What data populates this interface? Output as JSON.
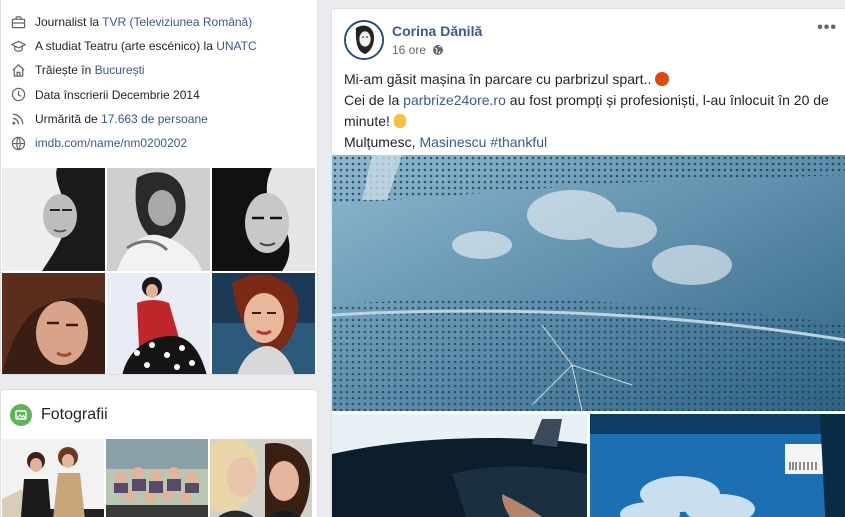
{
  "intro": {
    "work": {
      "prefix": "Journalist la ",
      "org": "TVR",
      "suffix": " (Televiziunea Română)"
    },
    "education": {
      "prefix": "A studiat Teatru (arte escénico) la ",
      "school": "UNATC"
    },
    "lives": {
      "prefix": "Trăiește în ",
      "city": "București"
    },
    "joined": "Data înscrierii Decembrie 2014",
    "followers": {
      "prefix": "Urmărită de ",
      "count": "17.663 de persoane"
    },
    "website": "imdb.com/name/nm0200202"
  },
  "photos_section": {
    "title": "Fotografii"
  },
  "post": {
    "author": "Corina Dănilă",
    "time": "16 ore",
    "more": "•••",
    "line1": "Mi-am găsit mașina în parcare cu parbrizul spart..",
    "line2_prefix": "Cei de la ",
    "line2_link": "parbrize24ore.ro",
    "line2_suffix": " au fost prompți și profesioniști, l-au înlocuit în 20 de minute!",
    "line3_prefix": "Mulțumesc, ",
    "line3_link": "Masinescu",
    "line3_hashtag": "#thankful"
  },
  "colors": {
    "link": "#385898",
    "background": "#e9ebee",
    "photos_icon": "#5fb358"
  }
}
